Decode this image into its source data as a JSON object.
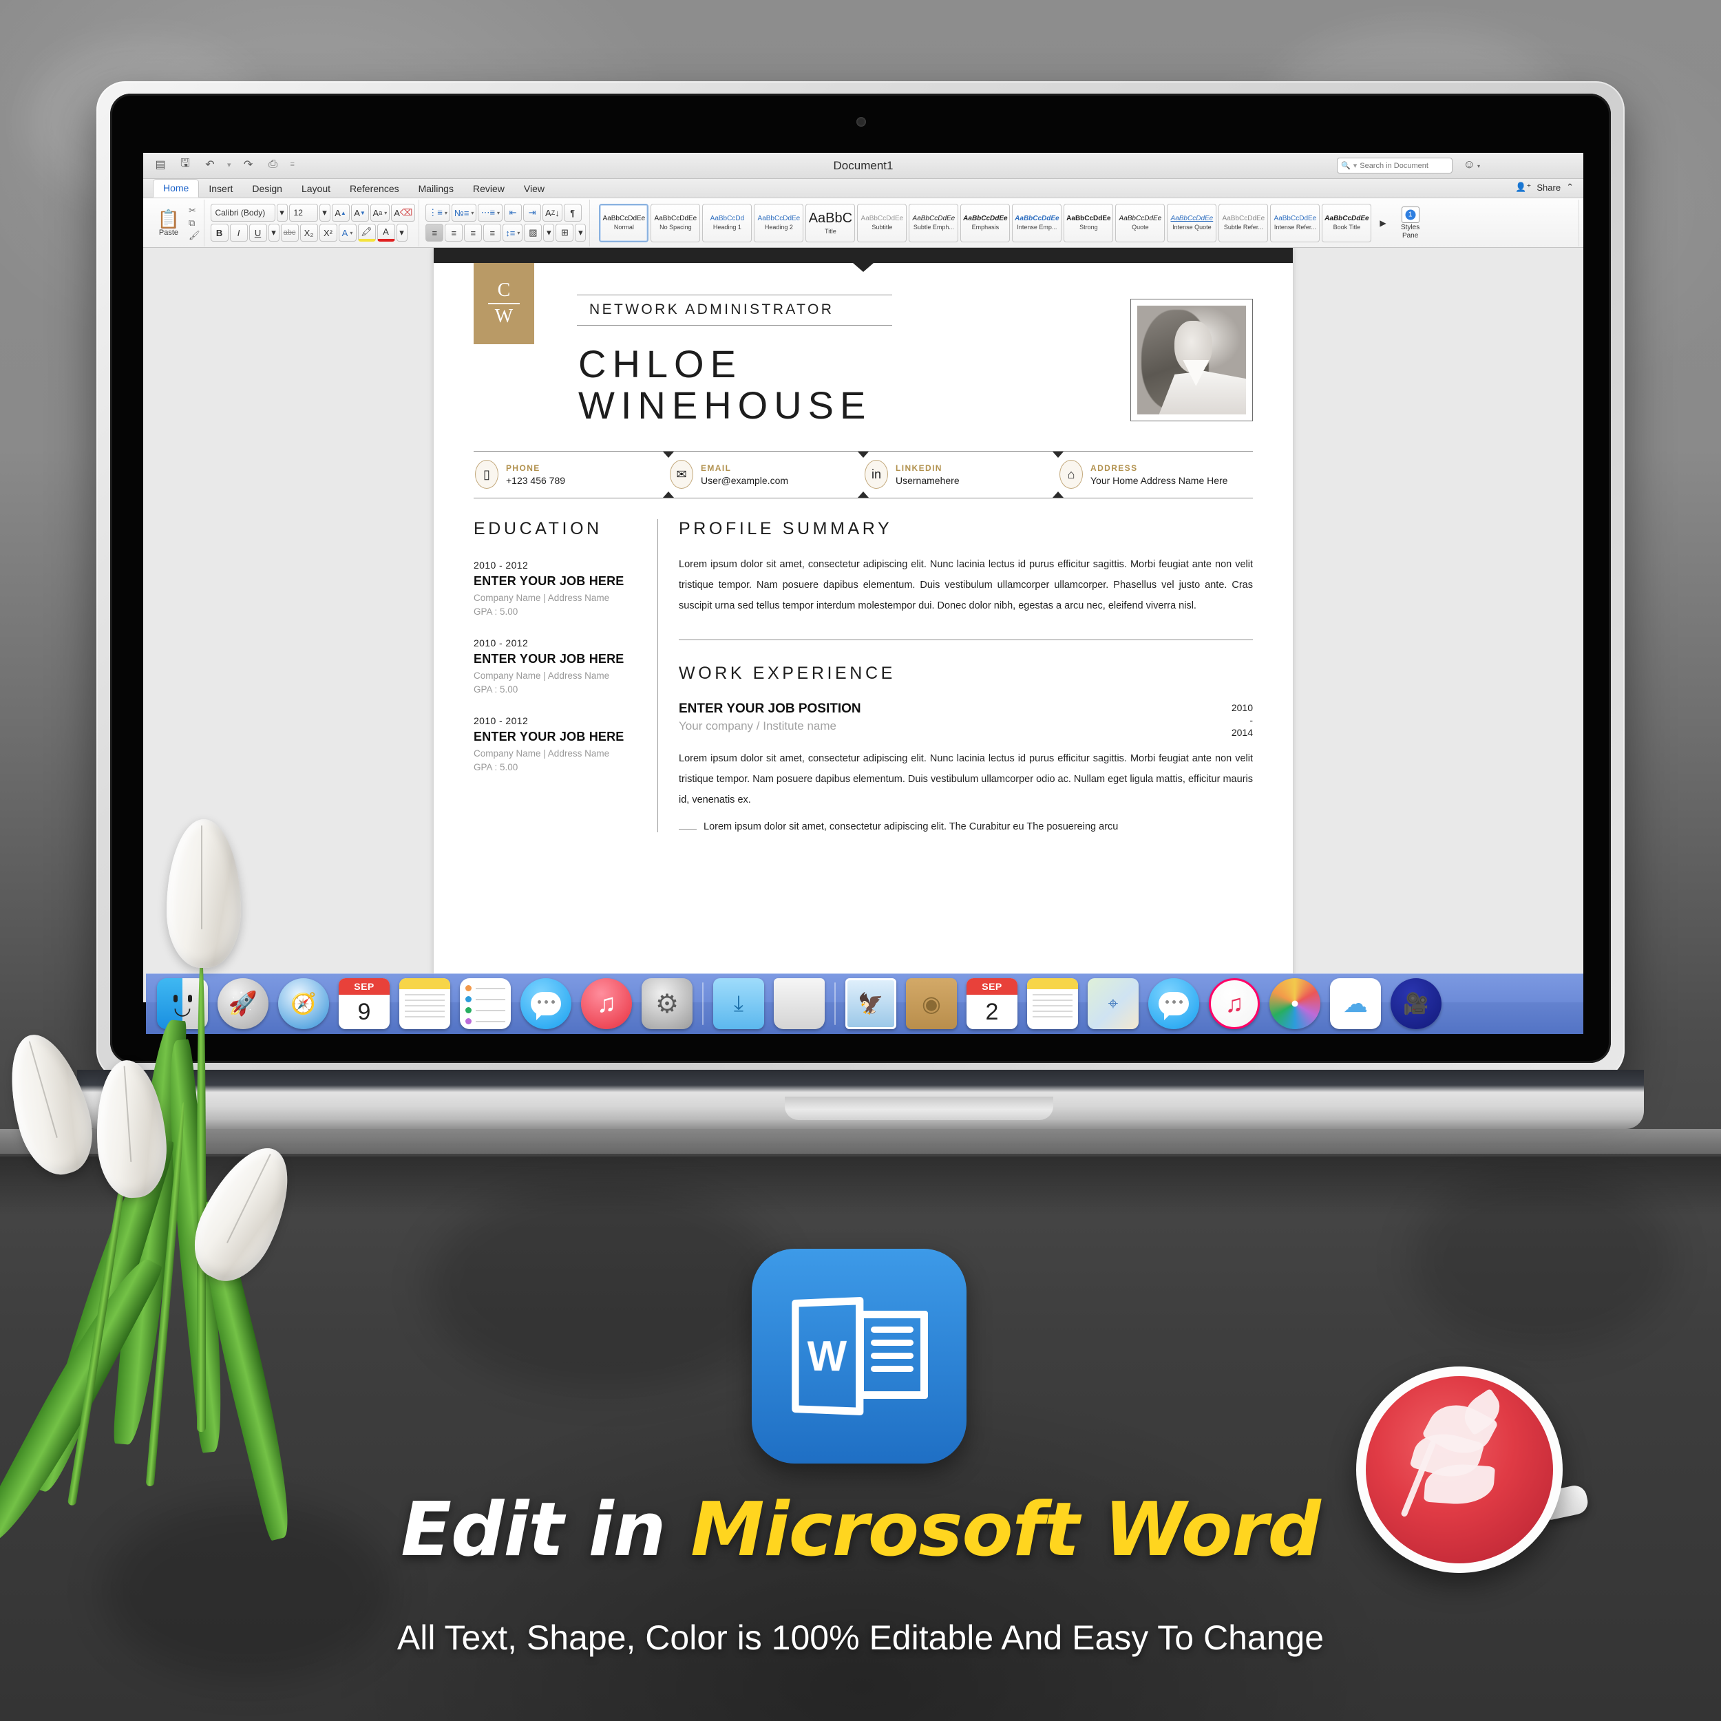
{
  "window": {
    "doc_title": "Document1",
    "quick_access": [
      "print-layout-icon",
      "save-icon",
      "undo-icon",
      "redo-icon",
      "print-icon",
      "customize-icon"
    ],
    "search": {
      "placeholder": "Search in Document",
      "value": ""
    },
    "smiley_label": "☺",
    "share_label": "Share"
  },
  "tabs": [
    {
      "label": "Home",
      "active": true
    },
    {
      "label": "Insert",
      "active": false
    },
    {
      "label": "Design",
      "active": false
    },
    {
      "label": "Layout",
      "active": false
    },
    {
      "label": "References",
      "active": false
    },
    {
      "label": "Mailings",
      "active": false
    },
    {
      "label": "Review",
      "active": false
    },
    {
      "label": "View",
      "active": false
    }
  ],
  "ribbon": {
    "paste_label": "Paste",
    "font_name": "Calibri (Body)",
    "font_size": "12",
    "grow_font": "A",
    "shrink_font": "A",
    "change_case": "Aa",
    "clear_format": "A",
    "bold": "B",
    "italic": "I",
    "underline": "U",
    "strikethrough": "abc",
    "subscript": "X₂",
    "superscript": "X²",
    "text_effects": "A",
    "highlight": "A",
    "font_color": "A",
    "bullets": "≔",
    "numbering": "≔",
    "multilevel": "≔",
    "decrease_indent": "⇤",
    "increase_indent": "⇥",
    "sort": "A↓",
    "show_marks": "¶",
    "align_left": "≡",
    "align_center": "≡",
    "align_right": "≡",
    "justify": "≡",
    "line_spacing": "↕",
    "shading": "▨",
    "borders": "⊞",
    "styles_pane_label_1": "Styles",
    "styles_pane_label_2": "Pane",
    "styles_more": "▶"
  },
  "styles": [
    {
      "preview": "AaBbCcDdEe",
      "label": "Normal",
      "selected": true
    },
    {
      "preview": "AaBbCcDdEe",
      "label": "No Spacing",
      "selected": false
    },
    {
      "preview": "AaBbCcDd",
      "label": "Heading 1",
      "selected": false
    },
    {
      "preview": "AaBbCcDdEe",
      "label": "Heading 2",
      "selected": false
    },
    {
      "preview": "AaBbC",
      "label": "Title",
      "selected": false
    },
    {
      "preview": "AaBbCcDdEe",
      "label": "Subtitle",
      "selected": false
    },
    {
      "preview": "AaBbCcDdEe",
      "label": "Subtle Emph...",
      "selected": false
    },
    {
      "preview": "AaBbCcDdEe",
      "label": "Emphasis",
      "selected": false
    },
    {
      "preview": "AaBbCcDdEe",
      "label": "Intense Emp...",
      "selected": false
    },
    {
      "preview": "AaBbCcDdEe",
      "label": "Strong",
      "selected": false
    },
    {
      "preview": "AaBbCcDdEe",
      "label": "Quote",
      "selected": false
    },
    {
      "preview": "AaBbCcDdEe",
      "label": "Intense Quote",
      "selected": false
    },
    {
      "preview": "AaBbCcDdEe",
      "label": "Subtle Refer...",
      "selected": false
    },
    {
      "preview": "AaBbCcDdEe",
      "label": "Intense Refer...",
      "selected": false
    },
    {
      "preview": "AaBbCcDdEe",
      "label": "Book Title",
      "selected": false
    }
  ],
  "resume": {
    "monogram": {
      "top": "C",
      "bottom": "W"
    },
    "job_title": "NETWORK ADMINISTRATOR",
    "first_name": "CHLOE",
    "last_name": "WINEHOUSE",
    "photo_alt": "portrait-photo",
    "contacts": [
      {
        "icon": "phone-icon",
        "glyph": "▯",
        "label": "PHONE",
        "value": "+123 456 789"
      },
      {
        "icon": "email-icon",
        "glyph": "✉",
        "label": "EMAIL",
        "value": "User@example.com"
      },
      {
        "icon": "linkedin-icon",
        "glyph": "in",
        "label": "LINKEDIN",
        "value": "Usernamehere"
      },
      {
        "icon": "home-icon",
        "glyph": "⌂",
        "label": "ADDRESS",
        "value": "Your Home Address Name Here"
      }
    ],
    "education": {
      "heading": "EDUCATION",
      "items": [
        {
          "years": "2010 - 2012",
          "job": "ENTER YOUR JOB HERE",
          "meta": "Company Name |  Address Name",
          "gpa": "GPA : 5.00"
        },
        {
          "years": "2010 - 2012",
          "job": "ENTER YOUR JOB HERE",
          "meta": "Company Name |  Address Name",
          "gpa": "GPA : 5.00"
        },
        {
          "years": "2010 - 2012",
          "job": "ENTER YOUR JOB HERE",
          "meta": "Company Name |  Address Name",
          "gpa": "GPA : 5.00"
        }
      ]
    },
    "profile": {
      "heading": "PROFILE SUMMARY",
      "text": "Lorem ipsum dolor sit amet, consectetur adipiscing elit. Nunc lacinia lectus id purus efficitur sagittis. Morbi feugiat ante non velit tristique tempor. Nam posuere dapibus elementum. Duis vestibulum ullamcorper ullamcorper. Phasellus vel justo ante. Cras suscipit urna sed tellus tempor interdum molestempor dui. Donec dolor nibh, egestas a arcu nec, eleifend viverra nisl."
    },
    "work": {
      "heading": "WORK EXPERIENCE",
      "position": "ENTER YOUR JOB POSITION",
      "company": "Your company / Institute name",
      "date_start": "2010",
      "date_dash": "-",
      "date_end": "2014",
      "text": "Lorem ipsum dolor sit amet, consectetur adipiscing elit. Nunc lacinia lectus id purus efficitur sagittis. Morbi feugiat ante non velit tristique tempor. Nam posuere dapibus elementum. Duis vestibulum ullamcorper odio ac. Nullam eget ligula mattis, efficitur mauris id, venenatis ex.",
      "clipped_line": "Lorem ipsum dolor sit amet, consectetur adipiscing elit. The Curabitur eu The posuereing arcu"
    }
  },
  "dock": [
    {
      "name": "finder",
      "label": "Finder"
    },
    {
      "name": "launchpad",
      "label": "Launchpad"
    },
    {
      "name": "safari",
      "label": "Safari"
    },
    {
      "name": "calendar",
      "label": "Calendar",
      "month": "SEP",
      "day": "9"
    },
    {
      "name": "notes",
      "label": "Notes"
    },
    {
      "name": "reminders",
      "label": "Reminders"
    },
    {
      "name": "messages",
      "label": "Messages"
    },
    {
      "name": "itunes",
      "label": "iTunes"
    },
    {
      "name": "system-preferences",
      "label": "System Preferences"
    },
    {
      "name": "downloads",
      "label": "Downloads"
    },
    {
      "name": "trash",
      "label": "Trash"
    },
    {
      "name": "mail",
      "label": "Mail"
    },
    {
      "name": "contacts",
      "label": "Contacts"
    },
    {
      "name": "calendar-2",
      "label": "Calendar",
      "month": "SEP",
      "day": "2"
    },
    {
      "name": "notes-2",
      "label": "Notes"
    },
    {
      "name": "maps",
      "label": "Maps"
    },
    {
      "name": "messages-2",
      "label": "Messages"
    },
    {
      "name": "itunes-2",
      "label": "iTunes"
    },
    {
      "name": "photos",
      "label": "Photos"
    },
    {
      "name": "icloud",
      "label": "iCloud Drive"
    },
    {
      "name": "facetime",
      "label": "FaceTime"
    }
  ],
  "promo": {
    "headline_white": "Edit in",
    "headline_yellow": "Microsoft Word",
    "subline": "All Text, Shape, Color is 100% Editable And Easy To Change",
    "word_icon_letter": "W"
  },
  "colors": {
    "gold": "#b99a66",
    "gold_text": "#b2924f",
    "dark_bar": "#232323",
    "word_blue": "#1f6fc4",
    "yellow": "#ffd51f",
    "dock_blue": "#5678cd"
  }
}
